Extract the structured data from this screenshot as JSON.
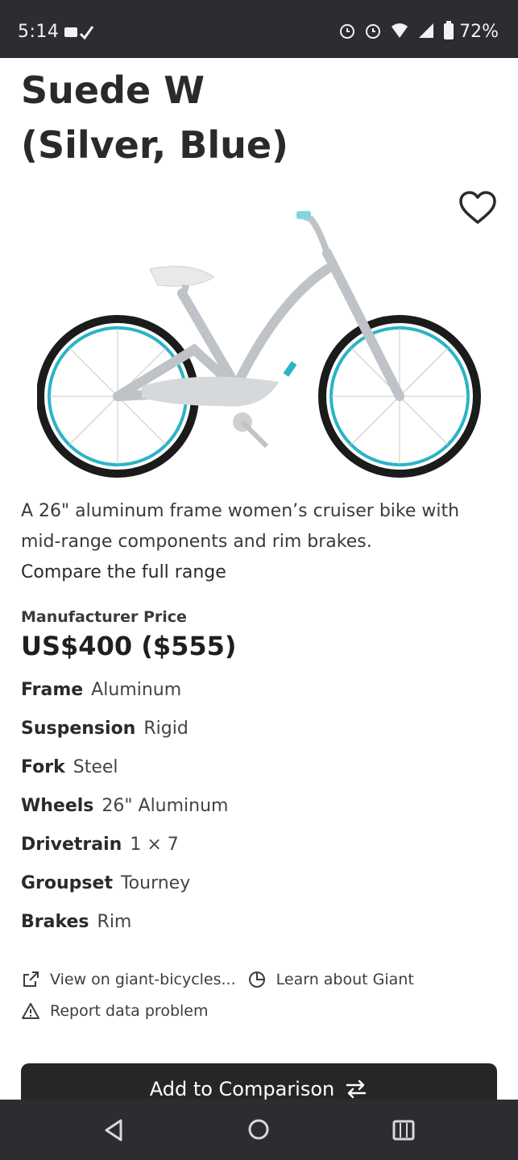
{
  "status_bar": {
    "time": "5:14",
    "battery": "72%"
  },
  "product": {
    "title_line1": "Suede W",
    "title_line2": "(Silver, Blue)",
    "description": "A 26\" aluminum frame women’s cruiser bike with mid-range components and rim brakes.",
    "compare_link": "Compare the full range",
    "price_label": "Manufacturer Price",
    "price": "US$400 ($555)"
  },
  "specs": [
    {
      "key": "Frame",
      "value": "Aluminum"
    },
    {
      "key": "Suspension",
      "value": "Rigid"
    },
    {
      "key": "Fork",
      "value": "Steel"
    },
    {
      "key": "Wheels",
      "value": "26\" Aluminum"
    },
    {
      "key": "Drivetrain",
      "value": "1 × 7"
    },
    {
      "key": "Groupset",
      "value": "Tourney"
    },
    {
      "key": "Brakes",
      "value": "Rim"
    }
  ],
  "links": {
    "view_on": "View on giant-bicycles...",
    "learn_about": "Learn about Giant",
    "report": "Report data problem"
  },
  "actions": {
    "add_to_comparison": "Add to Comparison"
  },
  "icons": {
    "favorite": "heart-icon",
    "external": "external-link-icon",
    "learn": "pie-chart-icon",
    "report": "warning-icon",
    "swap": "swap-arrows-icon"
  },
  "colors": {
    "status_bar_bg": "#2b2d31",
    "button_bg": "#262626",
    "rim_accent": "#2bb3c6"
  }
}
